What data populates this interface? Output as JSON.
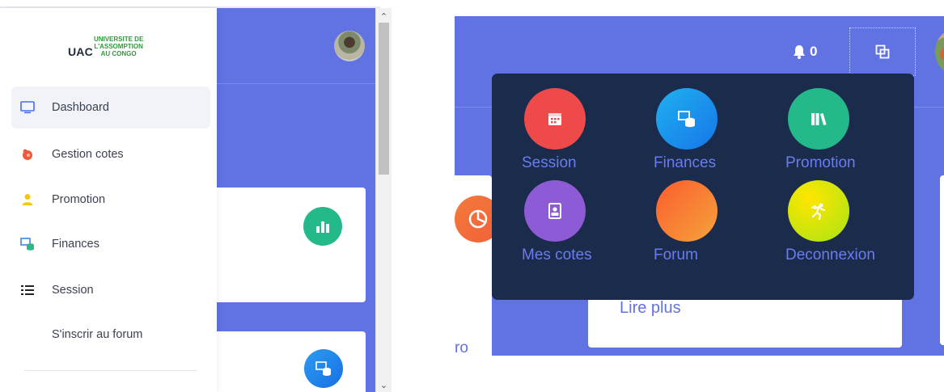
{
  "sidebar": {
    "brand_abbr": "UAC",
    "brand_line1": "UNIVERSITE DE",
    "brand_line2": "L'ASSOMPTION",
    "brand_line3": "AU CONGO",
    "items": [
      {
        "label": "Dashboard",
        "icon": "monitor-icon"
      },
      {
        "label": "Gestion cotes",
        "icon": "grade-icon"
      },
      {
        "label": "Promotion",
        "icon": "user-icon"
      },
      {
        "label": "Finances",
        "icon": "finance-icon"
      },
      {
        "label": "Session",
        "icon": "list-icon"
      },
      {
        "label": "S'inscrir au forum",
        "icon": ""
      }
    ]
  },
  "header": {
    "notification_count": "0"
  },
  "apps_menu": {
    "items": [
      {
        "label": "Session",
        "icon": "calendar-icon",
        "color": "#ee4a4a"
      },
      {
        "label": "Finances",
        "icon": "finance-icon",
        "color": "#1e90f0"
      },
      {
        "label": "Promotion",
        "icon": "books-icon",
        "color": "#23b98a"
      },
      {
        "label": "Mes cotes",
        "icon": "contact-book-icon",
        "color": "#8e5bd6"
      },
      {
        "label": "Forum",
        "icon": "",
        "color": "#f77f2e"
      },
      {
        "label": "Deconnexion",
        "icon": "running-icon",
        "color": "#d7e400"
      }
    ]
  },
  "content": {
    "lire_plus": "Lire plus",
    "partial_text": "ro"
  },
  "colors": {
    "primary": "#6172e3",
    "dropdown_bg": "#1b2b4b",
    "brand_green": "#2f9a3a"
  }
}
